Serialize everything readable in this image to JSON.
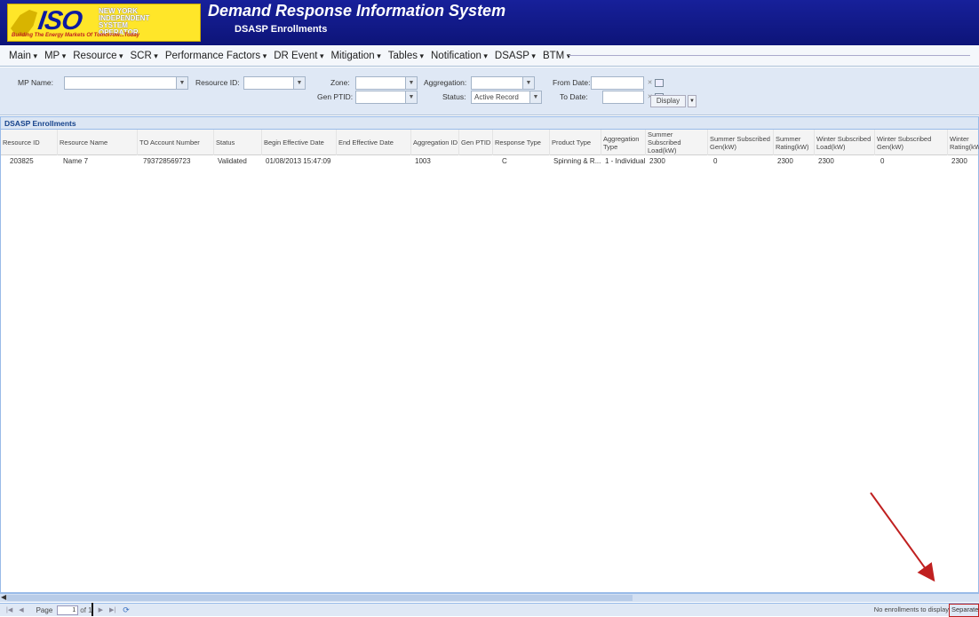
{
  "header": {
    "logo_text": "ISO",
    "logo_org": "NEW YORK INDEPENDENT SYSTEM OPERATOR",
    "logo_tagline": "Building The Energy Markets Of Tomorrow...Today",
    "app_title": "Demand Response Information System",
    "page_subtitle": "DSASP Enrollments"
  },
  "menu": [
    "Main",
    "MP",
    "Resource",
    "SCR",
    "Performance Factors",
    "DR Event",
    "Mitigation",
    "Tables",
    "Notification",
    "DSASP",
    "BTM"
  ],
  "filters": {
    "mp_name_label": "MP Name:",
    "mp_name_value": "",
    "resource_id_label": "Resource ID:",
    "resource_id_value": "",
    "zone_label": "Zone:",
    "zone_value": "",
    "gen_ptid_label": "Gen PTID:",
    "gen_ptid_value": "",
    "aggregation_label": "Aggregation:",
    "aggregation_value": "",
    "status_label": "Status:",
    "status_value": "Active Record",
    "from_date_label": "From Date:",
    "from_date_value": "",
    "to_date_label": "To Date:",
    "to_date_value": "",
    "display_button": "Display"
  },
  "grid": {
    "title": "DSASP Enrollments",
    "columns": [
      "Resource ID",
      "Resource Name",
      "TO Account Number",
      "Status",
      "Begin Effective Date",
      "End Effective Date",
      "Aggregation ID",
      "Gen PTID",
      "Response Type",
      "Product Type",
      "Aggregation Type",
      "Summer Subscribed Load(kW)",
      "Summer Subscribed Gen(kW)",
      "Summer Rating(kW)",
      "Winter Subscribed Load(kW)",
      "Winter Subscribed Gen(kW)",
      "Winter Rating(kW)"
    ],
    "rows": [
      [
        "203825",
        "Name 7",
        "793728569723",
        "Validated",
        "01/08/2013 15:47:09",
        "",
        "1003",
        "",
        "C",
        "Spinning & R...",
        "1 - Individual",
        "2300",
        "0",
        "2300",
        "2300",
        "0",
        "2300"
      ]
    ]
  },
  "pager": {
    "page_label": "Page",
    "page_value": "1",
    "page_of": "of 1",
    "status": "No enrollments to display",
    "separate_button": "Separate"
  }
}
